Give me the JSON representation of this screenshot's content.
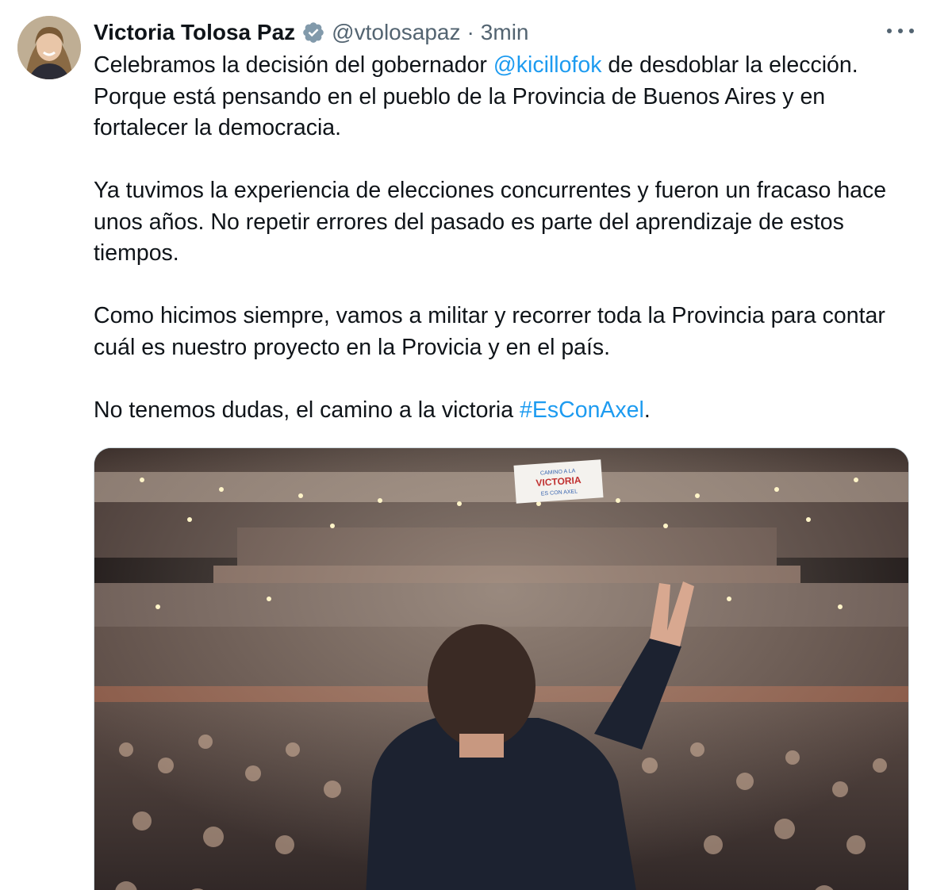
{
  "tweet": {
    "display_name": "Victoria Tolosa Paz",
    "handle": "@vtolosapaz",
    "separator": "·",
    "time": "3min",
    "avatar_icon": "profile-avatar",
    "verified_icon": "verified-badge-icon",
    "more_icon": "more-options-icon",
    "paragraphs": [
      {
        "before": "Celebramos la decisión del gobernador ",
        "mention": "@kicillofok",
        "after": " de desdoblar la elección. Porque está pensando en el pueblo de la Provincia de Buenos Aires y en fortalecer la democracia."
      },
      {
        "text": "Ya tuvimos la experiencia de elecciones concurrentes y fueron un fracaso hace unos años.  No repetir errores del pasado es parte del aprendizaje de estos tiempos."
      },
      {
        "text": "Como hicimos siempre, vamos a militar y recorrer toda la Provincia para contar cuál es nuestro proyecto en la Provicia y en el país."
      },
      {
        "before": "No tenemos dudas, el camino a la victoria ",
        "hashtag": "#EsConAxel",
        "after": "."
      }
    ],
    "media": {
      "banner_line1": "CAMINO A LA",
      "banner_line2": "VICTORIA",
      "banner_line3": "ES CON AXEL"
    }
  },
  "colors": {
    "text": "#0f1419",
    "secondary": "#536471",
    "link": "#1d9bf0",
    "verified_badge": "#829aab"
  }
}
